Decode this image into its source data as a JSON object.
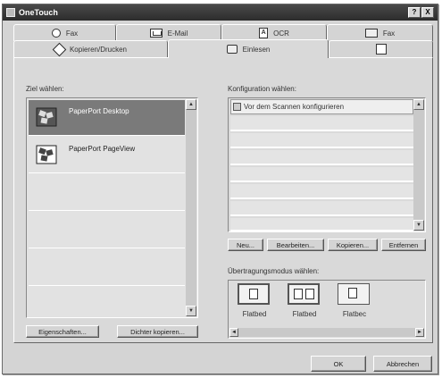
{
  "window": {
    "title": "OneTouch",
    "help_label": "?",
    "close_label": "X"
  },
  "tabs_row1": [
    {
      "label": "Fax",
      "icon": "fax-icon"
    },
    {
      "label": "E-Mail",
      "icon": "mail-icon"
    },
    {
      "label": "OCR",
      "icon": "ocr-icon"
    },
    {
      "label": "Fax",
      "icon": "fax-machine-icon"
    }
  ],
  "tabs_row2": [
    {
      "label": "Kopieren/Drucken",
      "icon": "copy-icon"
    },
    {
      "label": "Einlesen",
      "icon": "scan-icon",
      "active": true
    },
    {
      "label": "",
      "icon": "blank-tab-icon"
    }
  ],
  "ocr_glyph": "A",
  "target": {
    "label": "Ziel wählen:",
    "items": [
      {
        "label": "PaperPort Desktop",
        "selected": true
      },
      {
        "label": "PaperPort PageView",
        "selected": false
      }
    ],
    "properties_button": "Eigenschaften...",
    "copy_button": "Dichter kopieren..."
  },
  "config": {
    "label": "Konfiguration wählen:",
    "items": [
      "Vor dem Scannen konfigurieren"
    ],
    "buttons": {
      "new": "Neu...",
      "edit": "Bearbeiten...",
      "copy": "Kopieren...",
      "remove": "Entfernen"
    }
  },
  "transfer": {
    "label": "Übertragungsmodus wählen:",
    "modes": [
      "Flatbed",
      "Flatbed",
      "Flatbec"
    ]
  },
  "scroll": {
    "up": "▲",
    "down": "▼",
    "left": "◄",
    "right": "►"
  },
  "footer": {
    "ok": "OK",
    "cancel": "Abbrechen"
  }
}
